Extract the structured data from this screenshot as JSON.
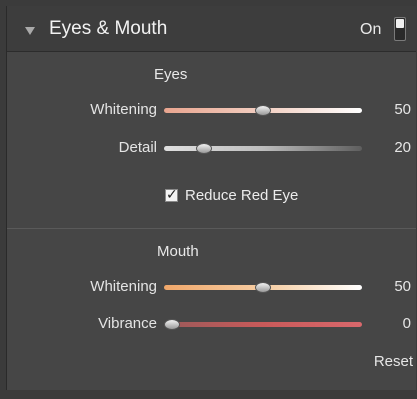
{
  "panel": {
    "title": "Eyes & Mouth",
    "toggle_label": "On",
    "toggle_on": true
  },
  "eyes": {
    "title": "Eyes",
    "whitening": {
      "label": "Whitening",
      "value": "50",
      "fraction": 0.5
    },
    "detail": {
      "label": "Detail",
      "value": "20",
      "fraction": 0.2
    },
    "reduce_red_eye": {
      "label": "Reduce Red Eye",
      "checked": true,
      "mark": "✓"
    }
  },
  "mouth": {
    "title": "Mouth",
    "whitening": {
      "label": "Whitening",
      "value": "50",
      "fraction": 0.5
    },
    "vibrance": {
      "label": "Vibrance",
      "value": "0",
      "fraction": 0.0
    }
  },
  "reset_label": "Reset",
  "colors": {
    "eyes_whitening_track": "#e9a58f",
    "detail_track": "#d9d9d9",
    "mouth_whitening_track": "#f0a76a",
    "vibrance_track": "#c95a5a"
  }
}
